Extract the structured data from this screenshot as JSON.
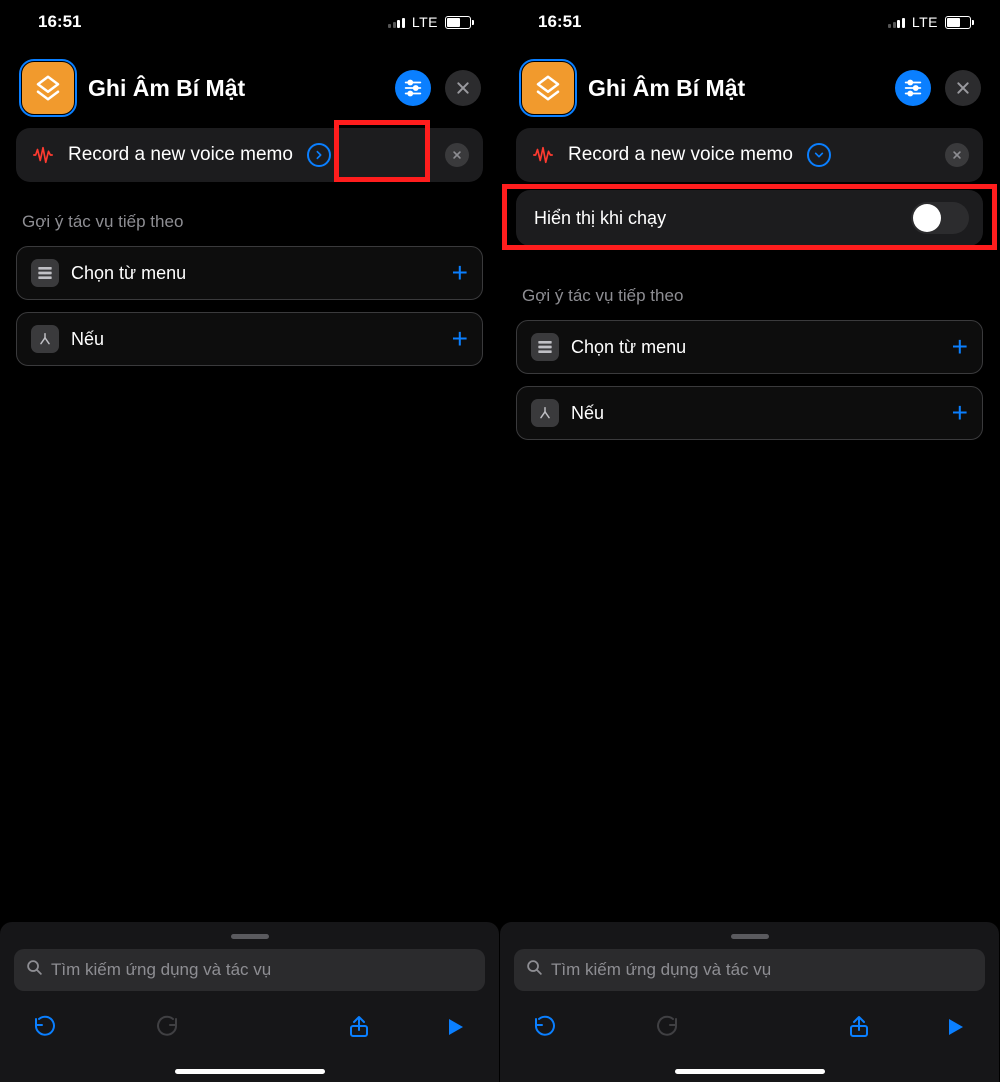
{
  "status": {
    "time": "16:51",
    "carrier": "LTE"
  },
  "header": {
    "title": "Ghi Âm Bí Mật"
  },
  "action": {
    "label": "Record a new voice memo"
  },
  "option": {
    "show_when_run": "Hiển thị khi chạy"
  },
  "suggest": {
    "header": "Gợi ý tác vụ tiếp theo",
    "items": [
      {
        "label": "Chọn từ menu"
      },
      {
        "label": "Nếu"
      }
    ]
  },
  "search": {
    "placeholder": "Tìm kiếm ứng dụng và tác vụ"
  }
}
